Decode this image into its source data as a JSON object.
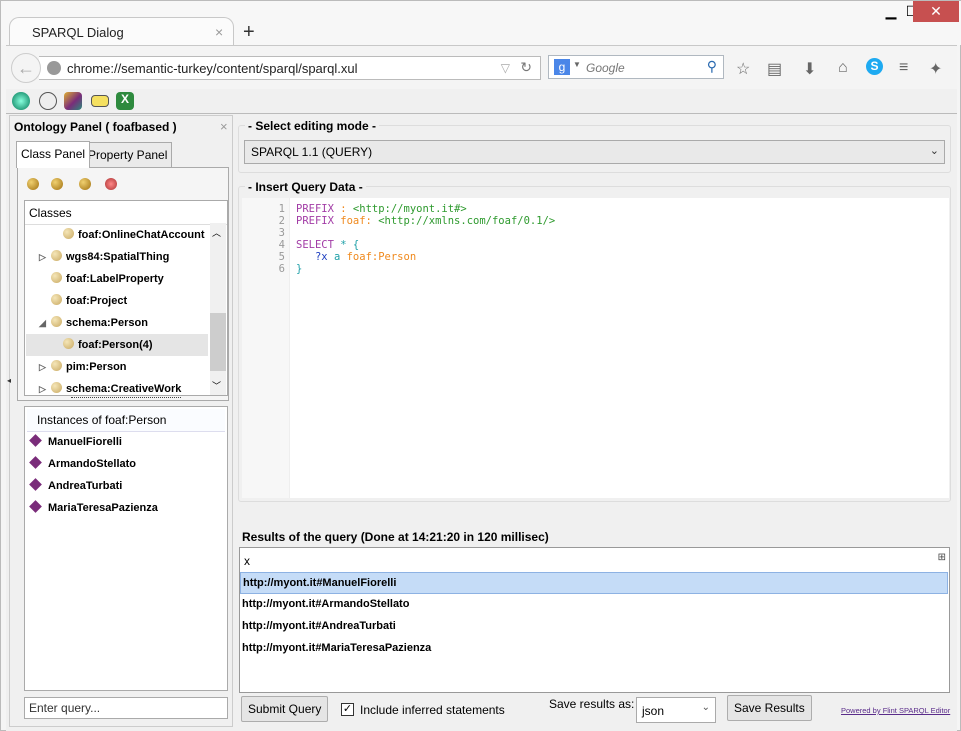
{
  "browser": {
    "tab_title": "SPARQL Dialog",
    "new_tab": "+",
    "tab_close": "×",
    "url": "chrome://semantic-turkey/content/sparql/sparql.xul",
    "search_placeholder": "Google",
    "window_controls": {
      "minimize": "▁",
      "maximize": "☐",
      "close": "✕"
    },
    "close_color": "#c75050"
  },
  "ontology_panel": {
    "title": "Ontology Panel ( foafbased )",
    "close": "×",
    "tabs": [
      "Class Panel",
      "Property Panel"
    ],
    "classes_header": "Classes",
    "classes": [
      {
        "label": "foaf:OnlineChatAccount",
        "level": 2,
        "twisty": ""
      },
      {
        "label": "wgs84:SpatialThing",
        "level": 1,
        "twisty": "▷"
      },
      {
        "label": "foaf:LabelProperty",
        "level": 1,
        "twisty": ""
      },
      {
        "label": "foaf:Project",
        "level": 1,
        "twisty": ""
      },
      {
        "label": "schema:Person",
        "level": 1,
        "twisty": "◢"
      },
      {
        "label": "foaf:Person(4)",
        "level": 2,
        "twisty": "",
        "selected": true
      },
      {
        "label": "pim:Person",
        "level": 1,
        "twisty": "▷"
      },
      {
        "label": "schema:CreativeWork",
        "level": 1,
        "twisty": "▷"
      }
    ],
    "instances_header": "Instances of foaf:Person",
    "instances": [
      "ManuelFiorelli",
      "ArmandoStellato",
      "AndreaTurbati",
      "MariaTeresaPazienza"
    ],
    "query_placeholder": "Enter query..."
  },
  "editing_mode": {
    "legend": "- Select editing mode -",
    "value": "SPARQL 1.1 (QUERY)"
  },
  "query": {
    "legend": "- Insert Query Data -",
    "colors": {
      "keyword": "#a23ca6",
      "prefix": "#f08a1e",
      "uri": "#2e9a2e",
      "var": "#2040c0",
      "punct": "#1fa0a8"
    },
    "lines": [
      [
        [
          "keyword",
          "PREFIX"
        ],
        [
          "plain",
          " "
        ],
        [
          "prefix",
          ":"
        ],
        [
          "plain",
          " "
        ],
        [
          "uri",
          "<http://myont.it#>"
        ]
      ],
      [
        [
          "keyword",
          "PREFIX"
        ],
        [
          "plain",
          " "
        ],
        [
          "prefix",
          "foaf:"
        ],
        [
          "plain",
          " "
        ],
        [
          "uri",
          "<http://xmlns.com/foaf/0.1/>"
        ]
      ],
      [],
      [
        [
          "keyword",
          "SELECT"
        ],
        [
          "plain",
          " "
        ],
        [
          "punct",
          "*"
        ],
        [
          "plain",
          " "
        ],
        [
          "punct",
          "{"
        ]
      ],
      [
        [
          "plain",
          "   "
        ],
        [
          "var",
          "?x"
        ],
        [
          "plain",
          " "
        ],
        [
          "punct",
          "a"
        ],
        [
          "plain",
          " "
        ],
        [
          "prefix",
          "foaf:Person"
        ]
      ],
      [
        [
          "punct",
          "}"
        ]
      ]
    ]
  },
  "results": {
    "label": "Results of the query (Done at 14:21:20  in 120 millisec)",
    "column": "x",
    "rows": [
      "http://myont.it#ManuelFiorelli",
      "http://myont.it#ArmandoStellato",
      "http://myont.it#AndreaTurbati",
      "http://myont.it#MariaTeresaPazienza"
    ],
    "selected_row": 0
  },
  "footer": {
    "submit": "Submit Query",
    "include_inferred": "Include inferred statements",
    "include_checked": true,
    "save_as_label": "Save results as:",
    "format": "json",
    "save": "Save Results",
    "powered": "Powered by Flint SPARQL Editor"
  }
}
